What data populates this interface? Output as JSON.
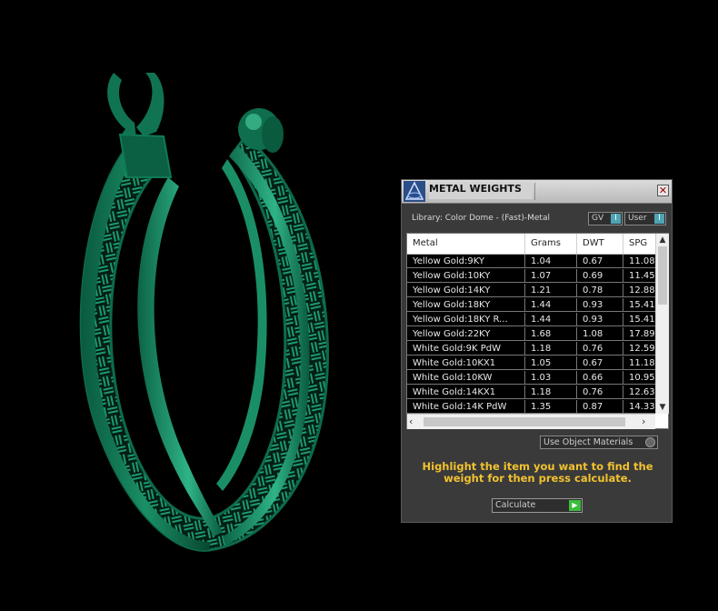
{
  "viewport": {
    "model": "earring-3d-model",
    "model_color": "#0e6e4e",
    "background": "#000000"
  },
  "panel": {
    "title": "METAL WEIGHTS",
    "close_glyph": "✕",
    "library_label": "Library: Color Dome - (Fast)-Metal",
    "toggles": [
      {
        "label": "GV",
        "glyph": "Ⅰ"
      },
      {
        "label": "User",
        "glyph": "Ⅰ"
      }
    ],
    "table": {
      "columns": [
        "Metal",
        "Grams",
        "DWT",
        "SPG"
      ],
      "rows": [
        [
          "Yellow Gold:9KY",
          "1.04",
          "0.67",
          "11.08"
        ],
        [
          "Yellow Gold:10KY",
          "1.07",
          "0.69",
          "11.45"
        ],
        [
          "Yellow Gold:14KY",
          "1.21",
          "0.78",
          "12.88"
        ],
        [
          "Yellow Gold:18KY",
          "1.44",
          "0.93",
          "15.41"
        ],
        [
          "Yellow Gold:18KY R...",
          "1.44",
          "0.93",
          "15.41"
        ],
        [
          "Yellow Gold:22KY",
          "1.68",
          "1.08",
          "17.89"
        ],
        [
          "White Gold:9K PdW",
          "1.18",
          "0.76",
          "12.59"
        ],
        [
          "White Gold:10KX1",
          "1.05",
          "0.67",
          "11.18"
        ],
        [
          "White Gold:10KW",
          "1.03",
          "0.66",
          "10.95"
        ],
        [
          "White Gold:14KX1",
          "1.18",
          "0.76",
          "12.63"
        ],
        [
          "White Gold:14K PdW",
          "1.35",
          "0.87",
          "14.33"
        ]
      ]
    },
    "use_object_materials": "Use Object Materials",
    "instruction": "Highlight the item you want to find the weight for then press calculate.",
    "calculate_label": "Calculate",
    "accent_color": "#f2c230"
  }
}
